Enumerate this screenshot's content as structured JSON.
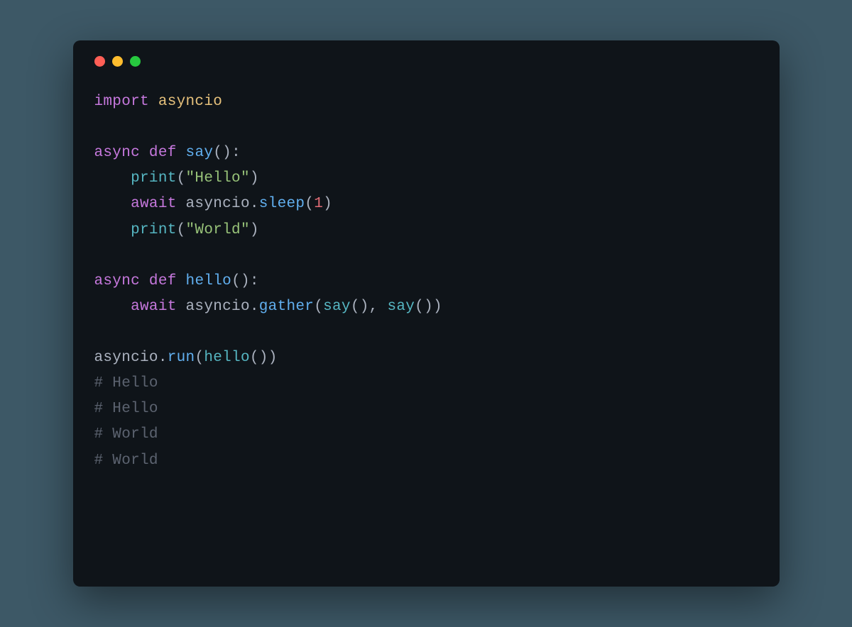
{
  "tokens": {
    "import": "import",
    "asyncio": "asyncio",
    "async": "async",
    "def": "def",
    "say": "say",
    "hello": "hello",
    "print": "print",
    "await": "await",
    "sleep": "sleep",
    "gather": "gather",
    "run": "run",
    "str_hello": "\"Hello\"",
    "str_world": "\"World\"",
    "num_1": "1",
    "dot": ".",
    "open_paren": "(",
    "close_paren": ")",
    "colon": ":",
    "comma_sp": ", ",
    "comment_hello": "# Hello",
    "comment_world": "# World"
  },
  "colors": {
    "background_page": "#3d5866",
    "background_window": "#0f1419",
    "red": "#ff5f56",
    "yellow": "#ffbd2e",
    "green": "#27c93f",
    "keyword": "#c678dd",
    "module": "#e5c07b",
    "function": "#61afef",
    "call": "#56b6c2",
    "string": "#98c379",
    "number": "#e06c75",
    "default": "#abb2bf",
    "comment": "#5c6370"
  }
}
